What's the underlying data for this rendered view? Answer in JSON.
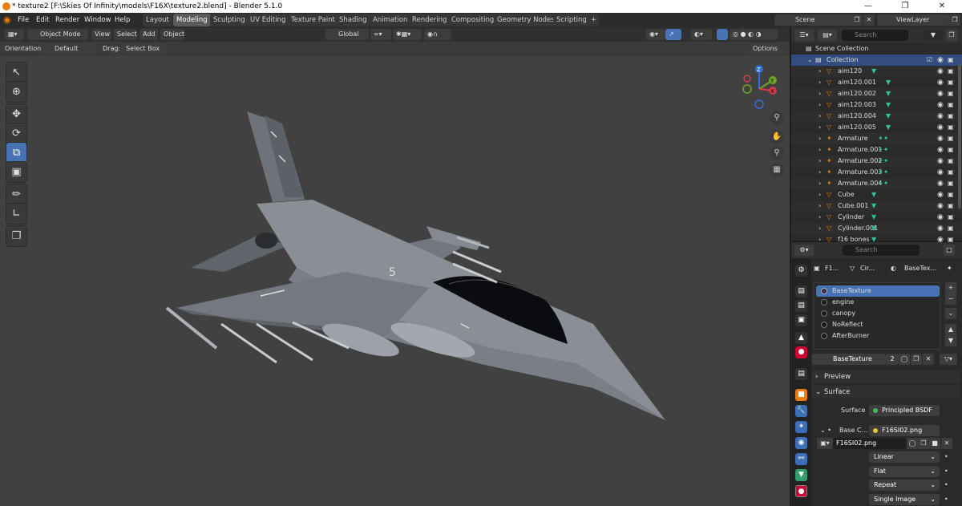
{
  "window": {
    "title": "* texture2 [F:\\Skies Of Infinity\\models\\F16X\\texture2.blend] - Blender 5.1.0"
  },
  "menu": [
    "File",
    "Edit",
    "Render",
    "Window",
    "Help"
  ],
  "workspaces": [
    "Layout",
    "Modeling",
    "Sculpting",
    "UV Editing",
    "Texture Paint",
    "Shading",
    "Animation",
    "Rendering",
    "Compositing",
    "Geometry Nodes",
    "Scripting"
  ],
  "workspace_add": "+",
  "scene": {
    "name": "Scene",
    "view_layer": "ViewLayer"
  },
  "viewport": {
    "mode": "Object Mode",
    "menus": [
      "View",
      "Select",
      "Add",
      "Object"
    ],
    "transform_orientation": "Global",
    "tool_settings": {
      "orientation_label": "Orientation:",
      "orientation_value": "Default",
      "drag_label": "Drag:",
      "drag_value": "Select Box",
      "options": "Options"
    },
    "gizmo": {
      "x": "X",
      "y": "Y",
      "z": "Z"
    }
  },
  "outliner": {
    "search_placeholder": "Search",
    "scene_collection": "Scene Collection",
    "collection": "Collection",
    "items": [
      "aim120",
      "aim120.001",
      "aim120.002",
      "aim120.003",
      "aim120.004",
      "aim120.005",
      "Armature",
      "Armature.001",
      "Armature.002",
      "Armature.003",
      "Armature.004",
      "Cube",
      "Cube.001",
      "Cylinder",
      "Cylinder.001",
      "f16 bones"
    ]
  },
  "properties": {
    "search_placeholder": "Search",
    "breadcrumb": [
      "F1...",
      "Cir...",
      "BaseTex..."
    ],
    "material_slots": [
      "BaseTexture",
      "engine",
      "canopy",
      "NoReflect",
      "AfterBurner"
    ],
    "active_material": "BaseTexture",
    "user_count": "2",
    "preview_label": "Preview",
    "surface_label": "Surface",
    "surface_field_label": "Surface",
    "surface_value": "Principled BSDF",
    "base_color_label": "Base C...",
    "base_color_value": "F16SI02.png",
    "image_name": "F16SI02.png",
    "interpolation": "Linear",
    "projection": "Flat",
    "extension": "Repeat",
    "source": "Single Image"
  }
}
